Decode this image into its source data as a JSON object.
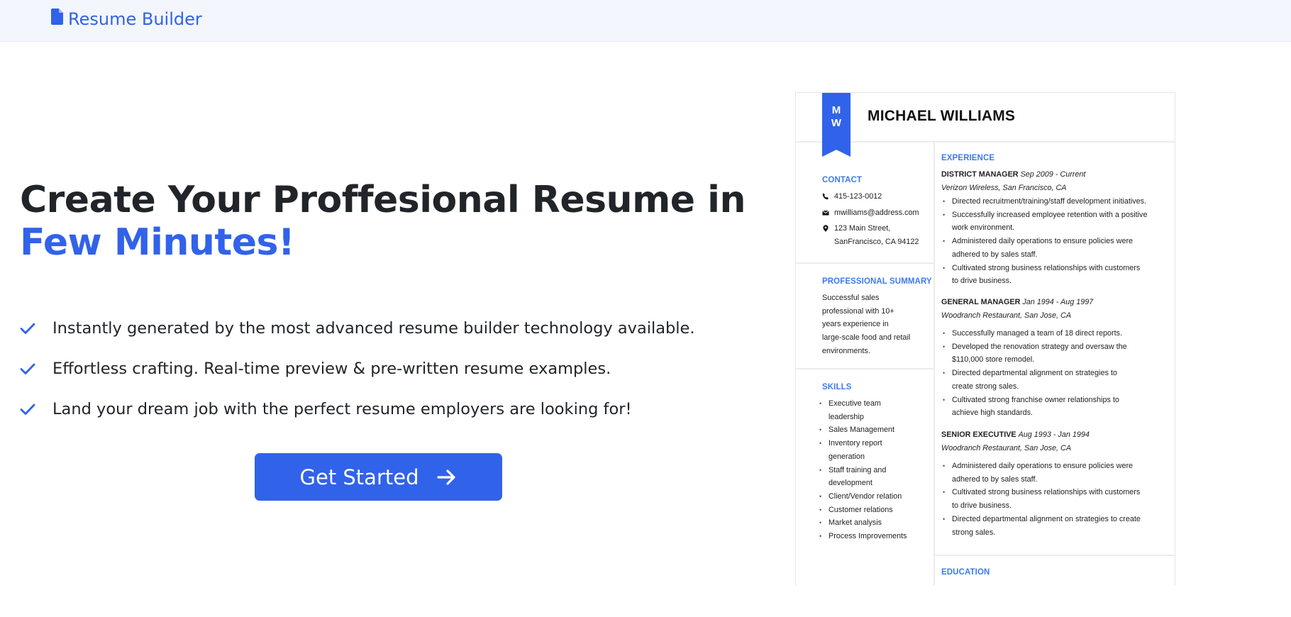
{
  "nav": {
    "brand": "Resume Builder"
  },
  "hero": {
    "title_main": "Create Your Proffesional Resume in ",
    "title_accent": "Few Minutes!",
    "features": [
      "Instantly generated by the most advanced resume builder technology available.",
      "Effortless crafting. Real-time preview & pre-written resume examples.",
      "Land your dream job with the perfect resume employers are looking for!"
    ],
    "cta_label": "Get Started"
  },
  "resume": {
    "initial_1": "M",
    "initial_2": "W",
    "name": "MICHAEL WILLIAMS",
    "contact_heading": "CONTACT",
    "phone": "415-123-0012",
    "email": "mwilliams@address.com",
    "address_line1": "123 Main Street,",
    "address_line2": "SanFrancisco, CA 94122",
    "summary_heading": "PROFESSIONAL SUMMARY",
    "summary_lines": [
      "Successful sales",
      "professional with 10+",
      "years experience in",
      "large-scale food and retail",
      "environments."
    ],
    "skills_heading": "SKILLS",
    "skills": [
      "Executive team",
      "leadership",
      "Sales Management",
      "Inventory report",
      "generation",
      "Staff training and",
      "development",
      "Client/Vendor relation",
      "Customer relations",
      "Market analysis",
      "Process Improvements"
    ],
    "experience_heading": "EXPERIENCE",
    "jobs": [
      {
        "title": "DISTRICT MANAGER",
        "dates": "Sep 2009 - Current",
        "company": "Verizon Wireless, San Francisco, CA",
        "bullets": [
          "Directed recruitment/training/staff development initiatives.",
          "Successfully increased employee retention with a positive",
          "work environment.",
          "Administered daily operations to ensure policies were",
          "adhered to by sales staff.",
          "Cultivated strong business relationships with customers",
          "to drive business."
        ]
      },
      {
        "title": "GENERAL MANAGER",
        "dates": "Jan 1994 - Aug 1997",
        "company": "Woodranch Restaurant, San Jose, CA",
        "bullets": [
          "Successfully managed a team of 18 direct reports.",
          "Developed the renovation strategy and oversaw the",
          "$110,000 store remodel.",
          "Directed departmental alignment on strategies to",
          "create strong sales.",
          "Cultivated strong franchise owner relationships to",
          "achieve high standards."
        ]
      },
      {
        "title": "SENIOR EXECUTIVE",
        "dates": "Aug 1993 - Jan 1994",
        "company": "Woodranch Restaurant, San Jose, CA",
        "bullets": [
          "Administered daily operations to ensure policies were",
          "adhered to by sales staff.",
          "Cultivated strong business relationships with customers",
          "to drive business.",
          "Directed departmental alignment on strategies to create",
          "strong sales."
        ]
      }
    ],
    "education_heading": "EDUCATION"
  },
  "colors": {
    "accent": "#3162ea",
    "navbar_bg": "#f3f6fd",
    "text": "#212529"
  }
}
